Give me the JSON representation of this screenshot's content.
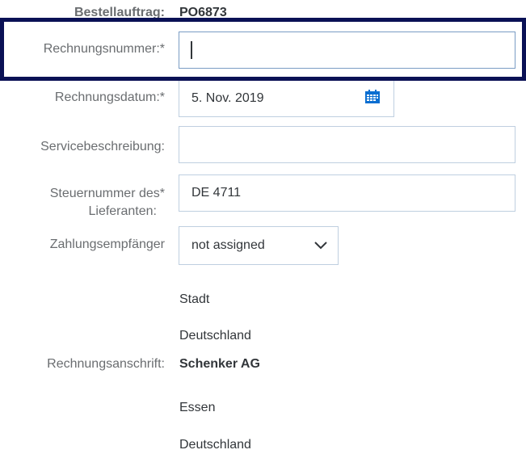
{
  "form": {
    "purchase_order": {
      "label": "Bestellauftrag:",
      "value": "PO6873"
    },
    "invoice_number": {
      "label": "Rechnungsnummer:",
      "required": "*",
      "value": ""
    },
    "invoice_date": {
      "label": "Rechnungsdatum:",
      "required": "*",
      "value": "5. Nov. 2019"
    },
    "service_description": {
      "label": "Servicebeschreibung:",
      "value": ""
    },
    "tax_number": {
      "label_line1": "Steuernummer des",
      "label_line2": "Lieferanten:",
      "required": "*",
      "value": "DE 4711"
    },
    "payee": {
      "label": "Zahlungsempfänger",
      "value": "not assigned"
    },
    "payee_address": {
      "line1": "Stadt",
      "line2": "Deutschland"
    },
    "billing_address": {
      "label": "Rechnungsanschrift:",
      "name": "Schenker AG",
      "city": "Essen",
      "country": "Deutschland"
    }
  },
  "icons": {
    "calendar": "calendar-icon",
    "dropdown": "chevron-down-icon"
  },
  "colors": {
    "highlight_border": "#0a1155",
    "field_border": "#bfcfe0",
    "calendar_icon": "#0a6ed1"
  }
}
